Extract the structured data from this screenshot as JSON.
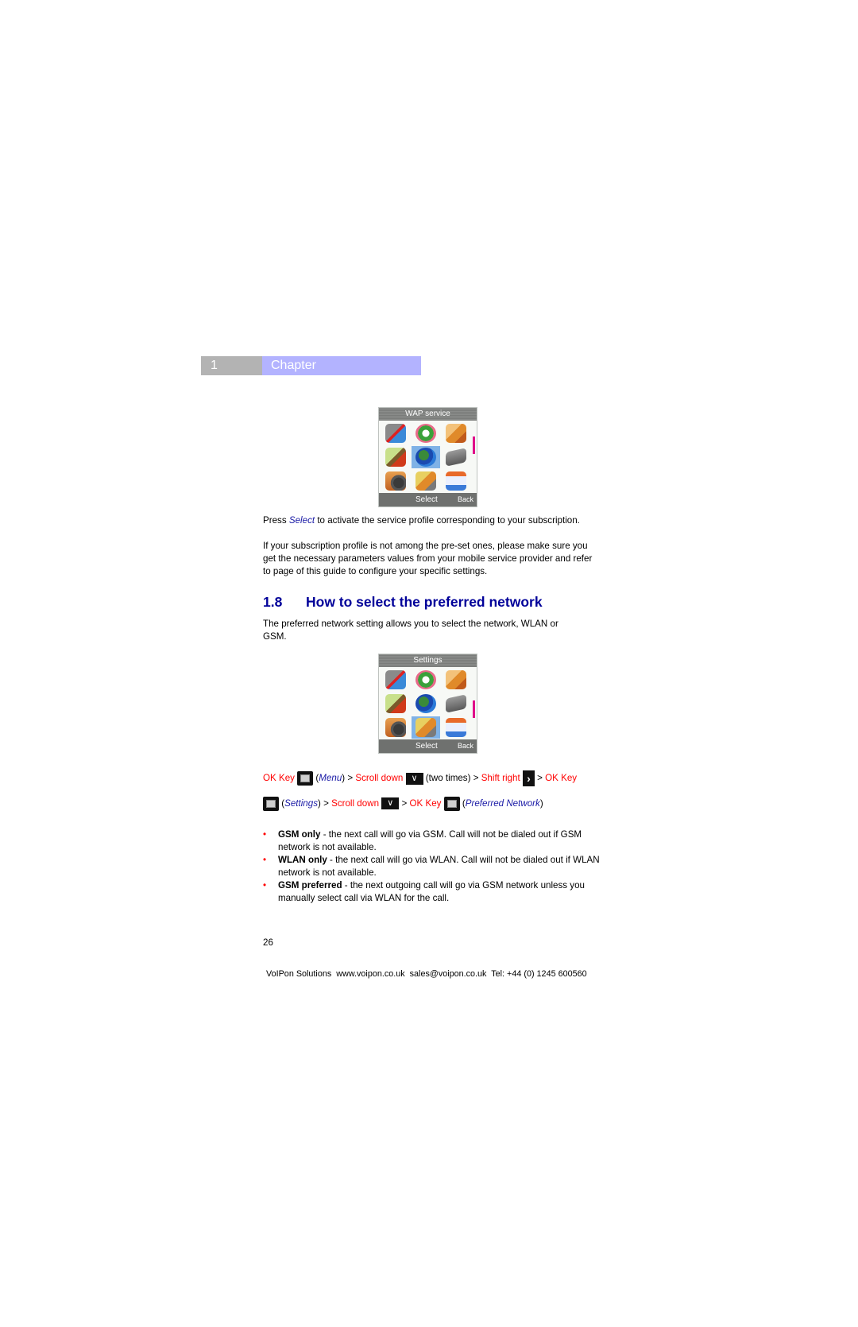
{
  "chapter": {
    "number": "1",
    "label": "Chapter",
    "colors": {
      "number_bg": "#b3b3b3",
      "label_bg": "#b3b3ff"
    }
  },
  "screens": [
    {
      "title": "WAP service",
      "softkey_left": "Select",
      "softkey_right": "Back",
      "icons": [
        "mailbox-icon",
        "phonebook-arrows-icon",
        "organizer-book-icon",
        "phone-tower-icon",
        "globe-icon",
        "cassette-icon",
        "camera-icon",
        "settings-phone-icon",
        "calendar-icon"
      ],
      "highlighted_index": 4
    },
    {
      "title": "Settings",
      "softkey_left": "Select",
      "softkey_right": "Back",
      "icons": [
        "mailbox-icon",
        "phonebook-arrows-icon",
        "organizer-book-icon",
        "phone-tower-icon",
        "globe-icon",
        "cassette-icon",
        "camera-icon",
        "settings-phone-icon",
        "calendar-icon"
      ],
      "highlighted_index": 7
    }
  ],
  "para1": {
    "prefix": "Press ",
    "emphasis": "Select",
    "suffix": " to activate the service profile corresponding to your subscription."
  },
  "para2": "If your subscription profile is not among the pre-set ones, please make sure you get the necessary parameters values from your mobile service provider and refer to page  of this guide to configure your specific settings.",
  "section": {
    "number": "1.8",
    "title": "How to select the preferred network"
  },
  "para3": "The preferred network setting allows you to select the network, WLAN or GSM.",
  "steps": {
    "line1": {
      "ok_key_1": "OK Key",
      "menu": "Menu",
      "gt1": " > ",
      "scroll_down_1": "Scroll down",
      "two_times": " (two times) > ",
      "shift_right": "Shift right",
      "gt2": " > ",
      "ok_key_2": "OK Key"
    },
    "line2": {
      "settings": "Settings",
      "gt1": " > ",
      "scroll_down": "Scroll down",
      "gt2": " > ",
      "ok_key": "OK Key",
      "preferred_network": "Preferred Network"
    },
    "colors": {
      "key_name": "#ff0000",
      "menu_name": "#1a1aa6"
    }
  },
  "options": [
    {
      "name": "GSM only",
      "text": " - the next call will go via GSM. Call will not be dialed out if GSM network is not available."
    },
    {
      "name": "WLAN only",
      "text": " - the next call will go via WLAN. Call will not be dialed out if WLAN network is not available."
    },
    {
      "name": "GSM preferred",
      "text": " - the next outgoing call will go via GSM network unless you manually select call via WLAN for the call."
    }
  ],
  "page_number": "26",
  "footer": "VoIPon Solutions  www.voipon.co.uk  sales@voipon.co.uk  Tel: +44 (0) 1245 600560"
}
